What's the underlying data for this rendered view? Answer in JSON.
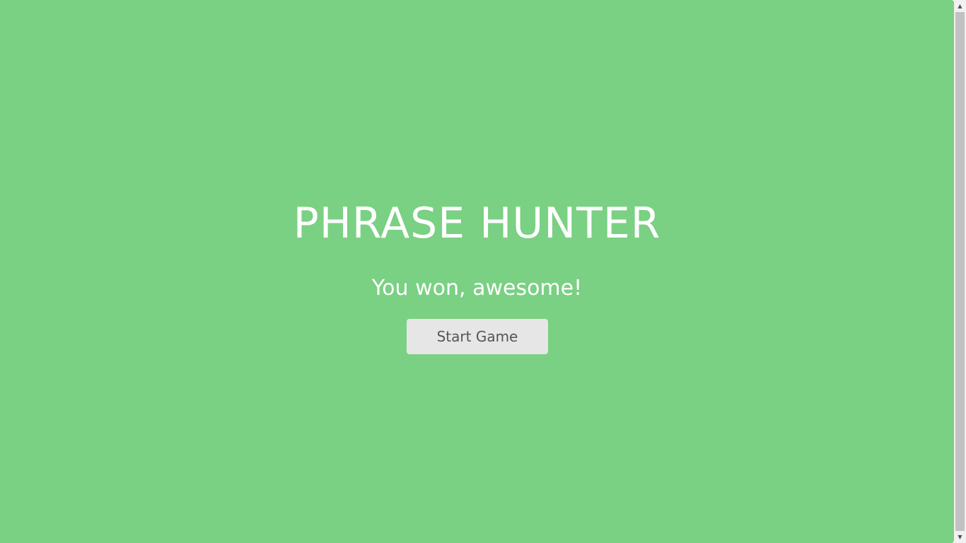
{
  "game": {
    "title": "PHRASE HUNTER",
    "message": "You won, awesome!",
    "start_button_label": "Start Game"
  },
  "colors": {
    "overlay_background": "#7ad083",
    "text": "#ffffff",
    "button_background": "#e6e6e6",
    "button_text": "#555555"
  },
  "scrollbar": {
    "up_icon": "triangle-up-icon",
    "down_icon": "triangle-down-icon"
  }
}
